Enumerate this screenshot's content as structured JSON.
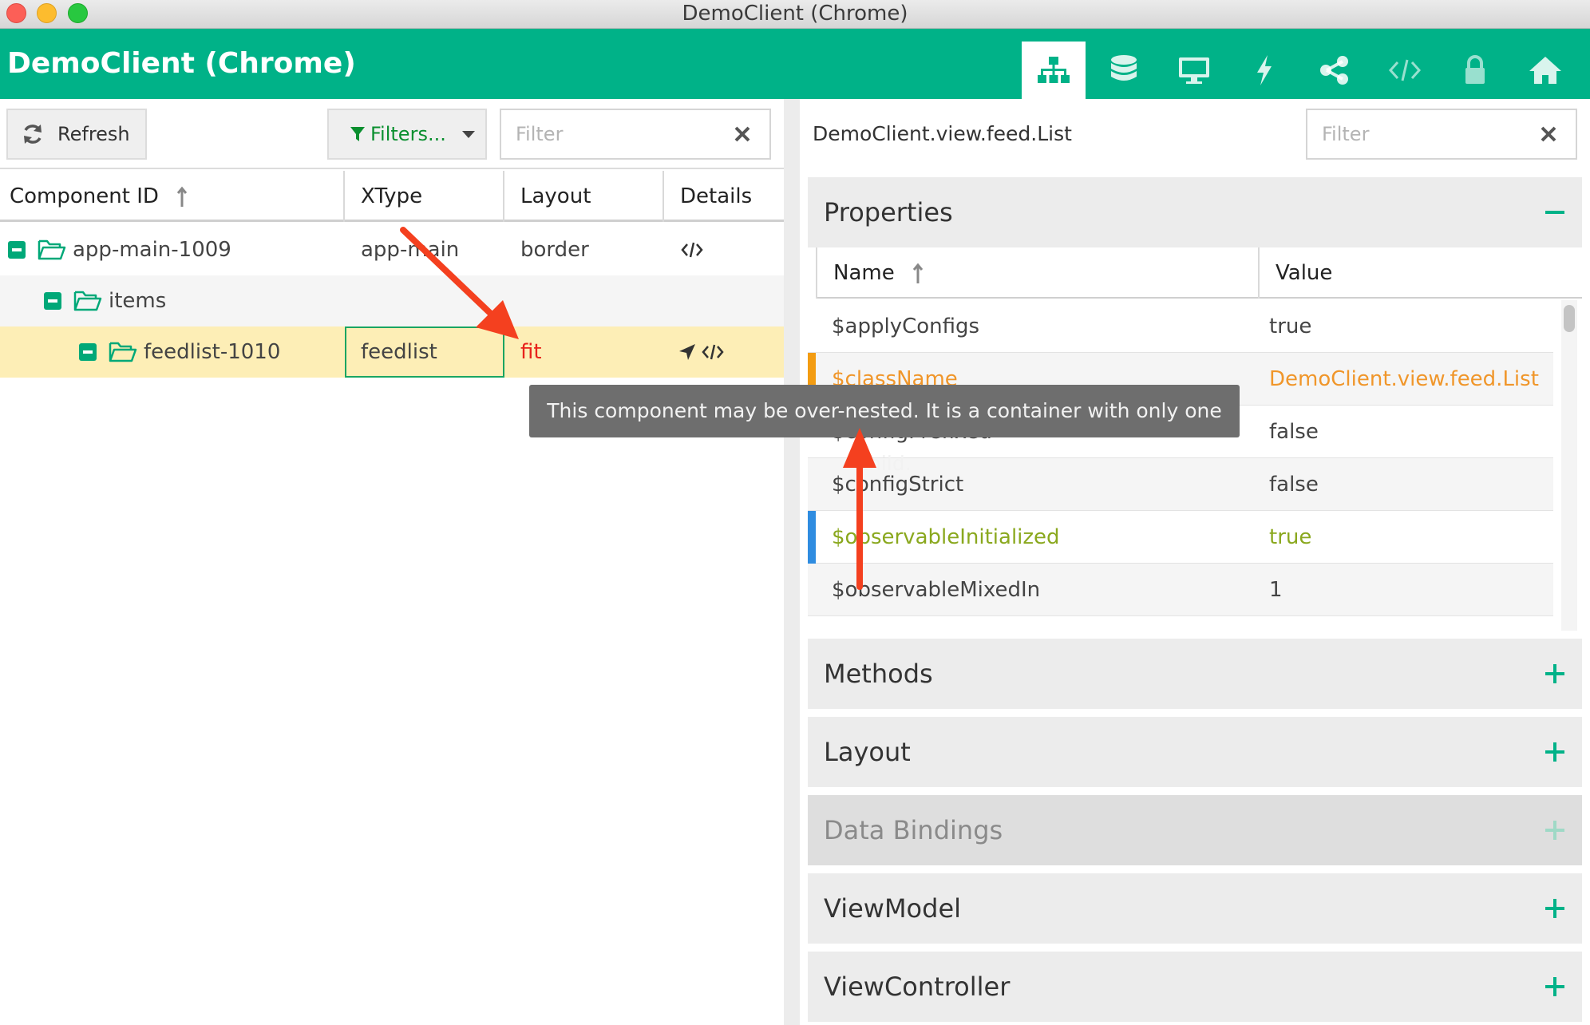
{
  "window": {
    "title": "DemoClient (Chrome)"
  },
  "app": {
    "title": "DemoClient (Chrome)",
    "accent": "#00b288",
    "nav_icons": [
      "component-tree-icon",
      "database-icon",
      "monitor-icon",
      "bolt-icon",
      "share-icon",
      "code-icon",
      "lock-icon",
      "home-icon"
    ]
  },
  "left": {
    "refresh_label": "Refresh",
    "filters_label": "Filters...",
    "filter_placeholder": "Filter",
    "columns": [
      "Component ID",
      "XType",
      "Layout",
      "Details"
    ],
    "rows": [
      {
        "id": "app-main-1009",
        "xtype": "app-main",
        "layout": "border"
      },
      {
        "id": "items",
        "xtype": "",
        "layout": ""
      },
      {
        "id": "feedlist-1010",
        "xtype": "feedlist",
        "layout": "fit"
      }
    ]
  },
  "right": {
    "title": "DemoClient.view.feed.List",
    "filter_placeholder": "Filter",
    "sections": {
      "properties": "Properties",
      "methods": "Methods",
      "layout": "Layout",
      "data_bindings": "Data Bindings",
      "viewmodel": "ViewModel",
      "viewcontroller": "ViewController"
    },
    "prop_columns": [
      "Name",
      "Value"
    ],
    "props": [
      {
        "name": "$applyConfigs",
        "value": "true",
        "color": "#444444"
      },
      {
        "name": "$className",
        "value": "DemoClient.view.feed.List",
        "color": "#f0962a"
      },
      {
        "name": "$configPrefixed",
        "value": "false",
        "color": "#444444"
      },
      {
        "name": "$configStrict",
        "value": "false",
        "color": "#444444"
      },
      {
        "name": "$observableInitialized",
        "value": "true",
        "color": "#8aa81e"
      },
      {
        "name": "$observableMixedIn",
        "value": "1",
        "color": "#444444"
      }
    ]
  },
  "tooltip": "This component may be over-nested. It is a container with only one child."
}
